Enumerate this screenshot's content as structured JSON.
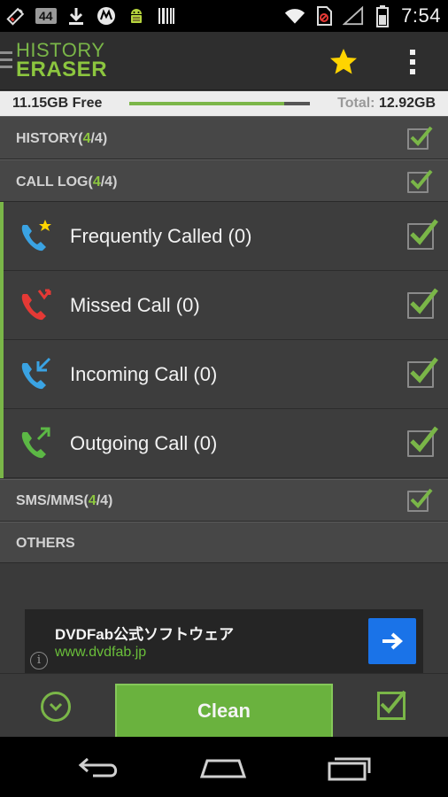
{
  "status_bar": {
    "notification_count": "44",
    "time": "7:54",
    "icons": [
      "battery-low-icon",
      "download-icon",
      "motorola-icon",
      "android-debug-icon",
      "barcode-icon",
      "wifi-icon",
      "no-sim-icon",
      "signal-icon",
      "battery-icon"
    ]
  },
  "app_bar": {
    "logo_line1": "HISTORY",
    "logo_line2": "ERASER",
    "icons": [
      "menu-icon",
      "star-icon",
      "overflow-icon"
    ]
  },
  "storage": {
    "free": "11.15GB Free",
    "total_label": "Total:",
    "total_value": "12.92GB",
    "used_fraction": 0.86
  },
  "sections": {
    "history": {
      "label": "HISTORY",
      "open": "(",
      "selected": "4",
      "sep": "/",
      "total": "4",
      "close": ")",
      "checked": true
    },
    "call_log": {
      "label": "CALL LOG",
      "open": "(",
      "selected": "4",
      "sep": "/",
      "total": "4",
      "close": ")",
      "checked": true
    },
    "sms": {
      "label": "SMS/MMS",
      "open": "(",
      "selected": "4",
      "sep": "/",
      "total": "4",
      "close": ")",
      "checked": true
    },
    "others": {
      "label": "OTHERS"
    }
  },
  "call_items": [
    {
      "label": "Frequently Called (0)",
      "icon": "phone-star-icon",
      "checked": true
    },
    {
      "label": "Missed Call (0)",
      "icon": "phone-missed-icon",
      "checked": true
    },
    {
      "label": "Incoming Call (0)",
      "icon": "phone-incoming-icon",
      "checked": true
    },
    {
      "label": "Outgoing Call (0)",
      "icon": "phone-outgoing-icon",
      "checked": true
    }
  ],
  "ad": {
    "title": "DVDFab公式ソフトウェア",
    "url": "www.dvdfab.jp",
    "info": "i"
  },
  "bottom_bar": {
    "clean_label": "Clean"
  },
  "colors": {
    "accent_green": "#7ab648",
    "clean_button": "#6ab23e",
    "star": "#ffd400",
    "ad_button": "#1a73e8"
  }
}
